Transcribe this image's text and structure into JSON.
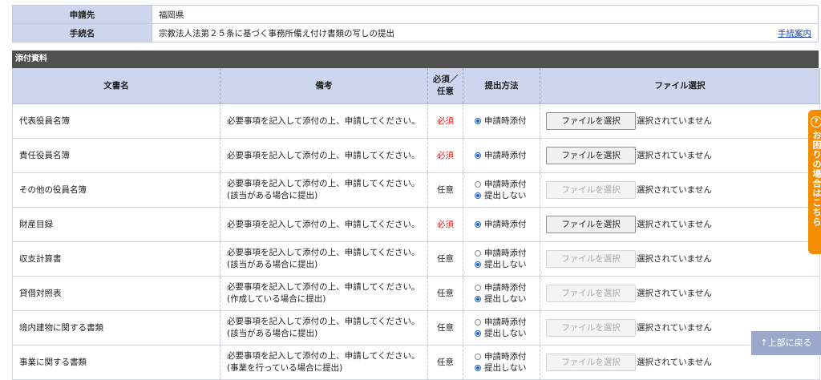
{
  "info": {
    "applicant_label": "申請先",
    "applicant_value": "福岡県",
    "procedure_label": "手続名",
    "procedure_value": "宗教法人法第２５条に基づく事務所備え付け書類の写しの提出",
    "guide_link": "手続案内"
  },
  "attachments": {
    "section_title": "添付資料",
    "headers": {
      "doc_name": "文書名",
      "remarks": "備考",
      "required_line1": "必須／",
      "required_line2": "任意",
      "method": "提出方法",
      "file": "ファイル選択"
    },
    "method_options": {
      "attach": "申請時添付",
      "none": "提出しない"
    },
    "file_button_label": "ファイルを選択",
    "no_file_text": "選択されていません",
    "rows": [
      {
        "name": "代表役員名簿",
        "remark1": "必要事項を記入して添付の上、申請してください。",
        "remark2": "",
        "req": "必須"
      },
      {
        "name": "責任役員名簿",
        "remark1": "必要事項を記入して添付の上、申請してください。",
        "remark2": "",
        "req": "必須"
      },
      {
        "name": "その他の役員名簿",
        "remark1": "必要事項を記入して添付の上、申請してください。",
        "remark2": "(該当がある場合に提出)",
        "req": "任意"
      },
      {
        "name": "財産目録",
        "remark1": "必要事項を記入して添付の上、申請してください。",
        "remark2": "",
        "req": "必須"
      },
      {
        "name": "収支計算書",
        "remark1": "必要事項を記入して添付の上、申請してください。",
        "remark2": "(該当がある場合に提出)",
        "req": "任意"
      },
      {
        "name": "貸借対照表",
        "remark1": "必要事項を記入して添付の上、申請してください。",
        "remark2": "(作成している場合に提出)",
        "req": "任意"
      },
      {
        "name": "境内建物に関する書類",
        "remark1": "必要事項を記入して添付の上、申請してください。",
        "remark2": "(該当がある場合に提出)",
        "req": "任意"
      },
      {
        "name": "事業に関する書類",
        "remark1": "必要事項を記入して添付の上、申請してください。",
        "remark2": "(事業を行っている場合に提出)",
        "req": "任意"
      }
    ]
  },
  "help_tab": {
    "text": "お困りの場合はこちら"
  },
  "back_to_top": "↑上部に戻る",
  "colors": {
    "required": "#d02020",
    "header_bg": "#cdd6ee",
    "section_bg": "#505050",
    "help_orange": "#f28c00"
  }
}
